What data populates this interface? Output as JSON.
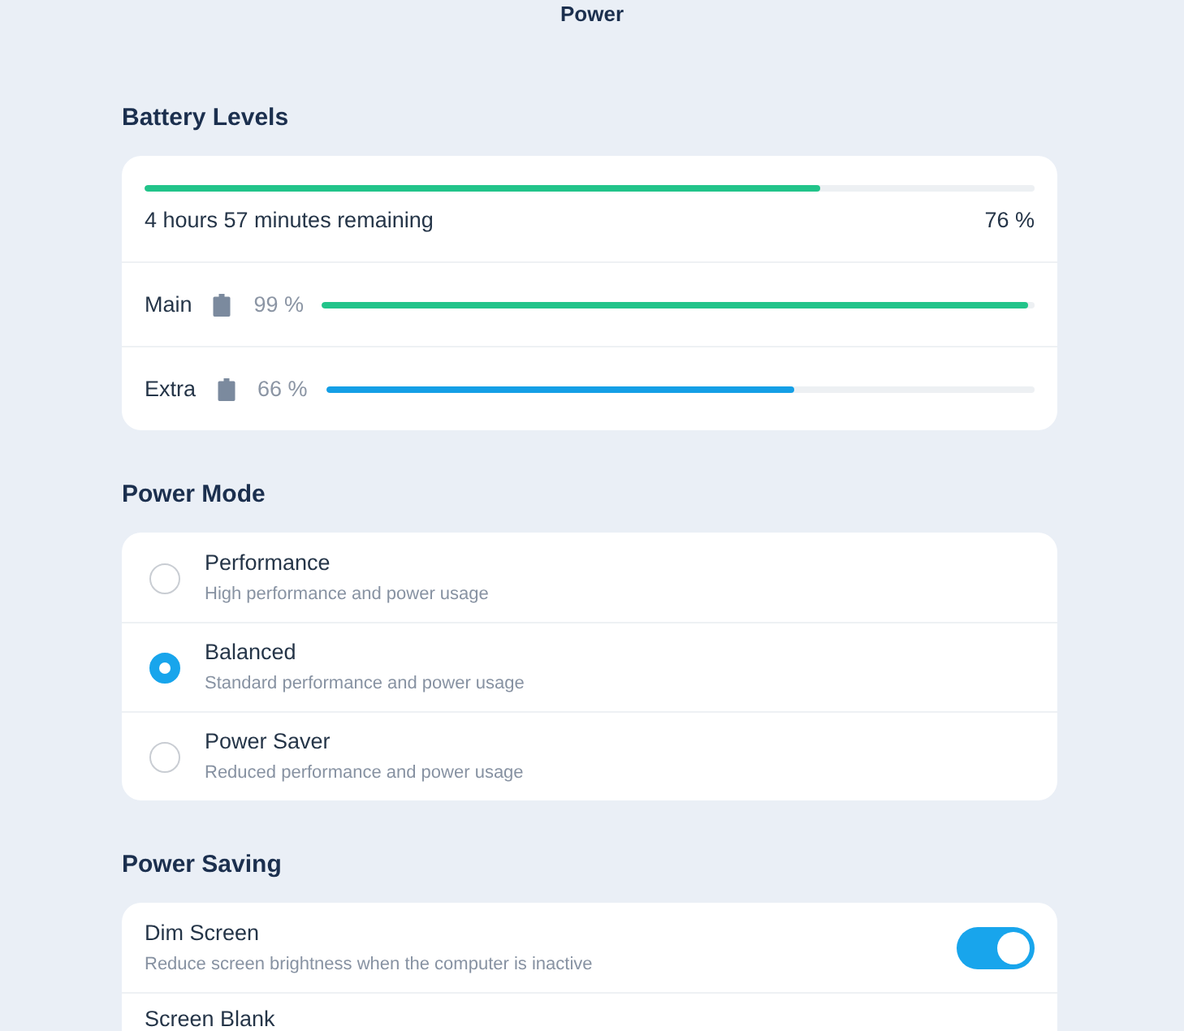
{
  "window": {
    "title": "Power"
  },
  "battery_levels": {
    "heading": "Battery Levels",
    "overall": {
      "level": 0.76,
      "remaining": "4 hours 57 minutes remaining",
      "reading": "76 %"
    },
    "batteries": [
      {
        "name": "Main",
        "reading": "99 %",
        "level": 0.99,
        "color": "#22c48a"
      },
      {
        "name": "Extra",
        "reading": "66 %",
        "level": 0.66,
        "color": "#149fe6"
      }
    ]
  },
  "power_mode": {
    "heading": "Power Mode",
    "options": [
      {
        "label": "Performance",
        "description": "High performance and power usage",
        "selected": false
      },
      {
        "label": "Balanced",
        "description": "Standard performance and power usage",
        "selected": true
      },
      {
        "label": "Power Saver",
        "description": "Reduced performance and power usage",
        "selected": false
      }
    ]
  },
  "power_saving": {
    "heading": "Power Saving",
    "settings": [
      {
        "kind": "toggle",
        "label": "Dim Screen",
        "description": "Reduce screen brightness when the computer is inactive",
        "on": true
      },
      {
        "kind": "plain",
        "label": "Screen Blank"
      }
    ]
  }
}
